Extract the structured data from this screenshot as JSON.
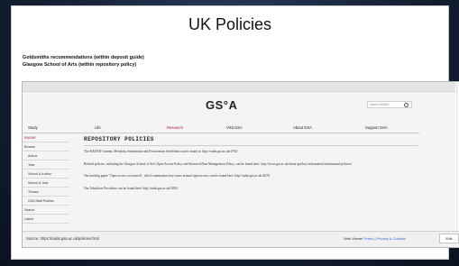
{
  "slide": {
    "title": "UK Policies",
    "line1": "Goldsmiths recommendations (within deposit guide)",
    "line2": "Glasgow School of Arts (within repository policy)"
  },
  "site": {
    "logo": "GS°A",
    "search_placeholder": "search RADAR",
    "nav": [
      "Study",
      "Life",
      "Research",
      "Visit GSA",
      "About GSA",
      "Support GSA"
    ],
    "nav_active": "Research",
    "left_nav": [
      {
        "label": "RADAR",
        "active": true,
        "indent": false
      },
      {
        "label": "Browse",
        "active": false,
        "indent": false
      },
      {
        "label": "Author",
        "active": false,
        "indent": true
      },
      {
        "label": "Year",
        "active": false,
        "indent": true
      },
      {
        "label": "School & Author",
        "active": false,
        "indent": true
      },
      {
        "label": "School & Year",
        "active": false,
        "indent": true
      },
      {
        "label": "Theses",
        "active": false,
        "indent": true
      },
      {
        "label": "GSA Staff Profiles",
        "active": false,
        "indent": true
      },
      {
        "label": "Search",
        "active": false,
        "indent": false
      },
      {
        "label": "Latest",
        "active": false,
        "indent": false
      }
    ],
    "heading": "REPOSITORY POLICIES",
    "paragraphs": [
      "The RADAR Content, Metadata, Submission and Preservation Guidelines can be found at: http://radar.gsa.ac.uk/4763/",
      "Related policies, including the Glasgow School of Art's Open Access Policy and Research Data Management Policy, can be found here: http://www.gsa.ac.uk/about-gsa/key-information/institutional-policies/",
      "Our briefing paper \"Open access to research\", which summarises key issues around open access, can be found here: http://radar.gsa.ac.uk/4676/",
      "Our Takedown Procedure can be found here: http://radar.gsa.ac.uk/5003/"
    ]
  },
  "status_bar": {
    "source": "Source: https://radar.gsa.ac.uk/policies.html",
    "viewer_label": "Web Viewer",
    "terms": "Terms",
    "privacy": "Privacy & Cookies",
    "separator": " | ",
    "edit": "Edit"
  },
  "icons": {
    "scroll_up": "chevron-up-icon",
    "scroll_down": "chevron-down-icon",
    "search": "search-icon"
  },
  "colors": {
    "accent": "#b4123c",
    "link": "#2a6bd2"
  }
}
